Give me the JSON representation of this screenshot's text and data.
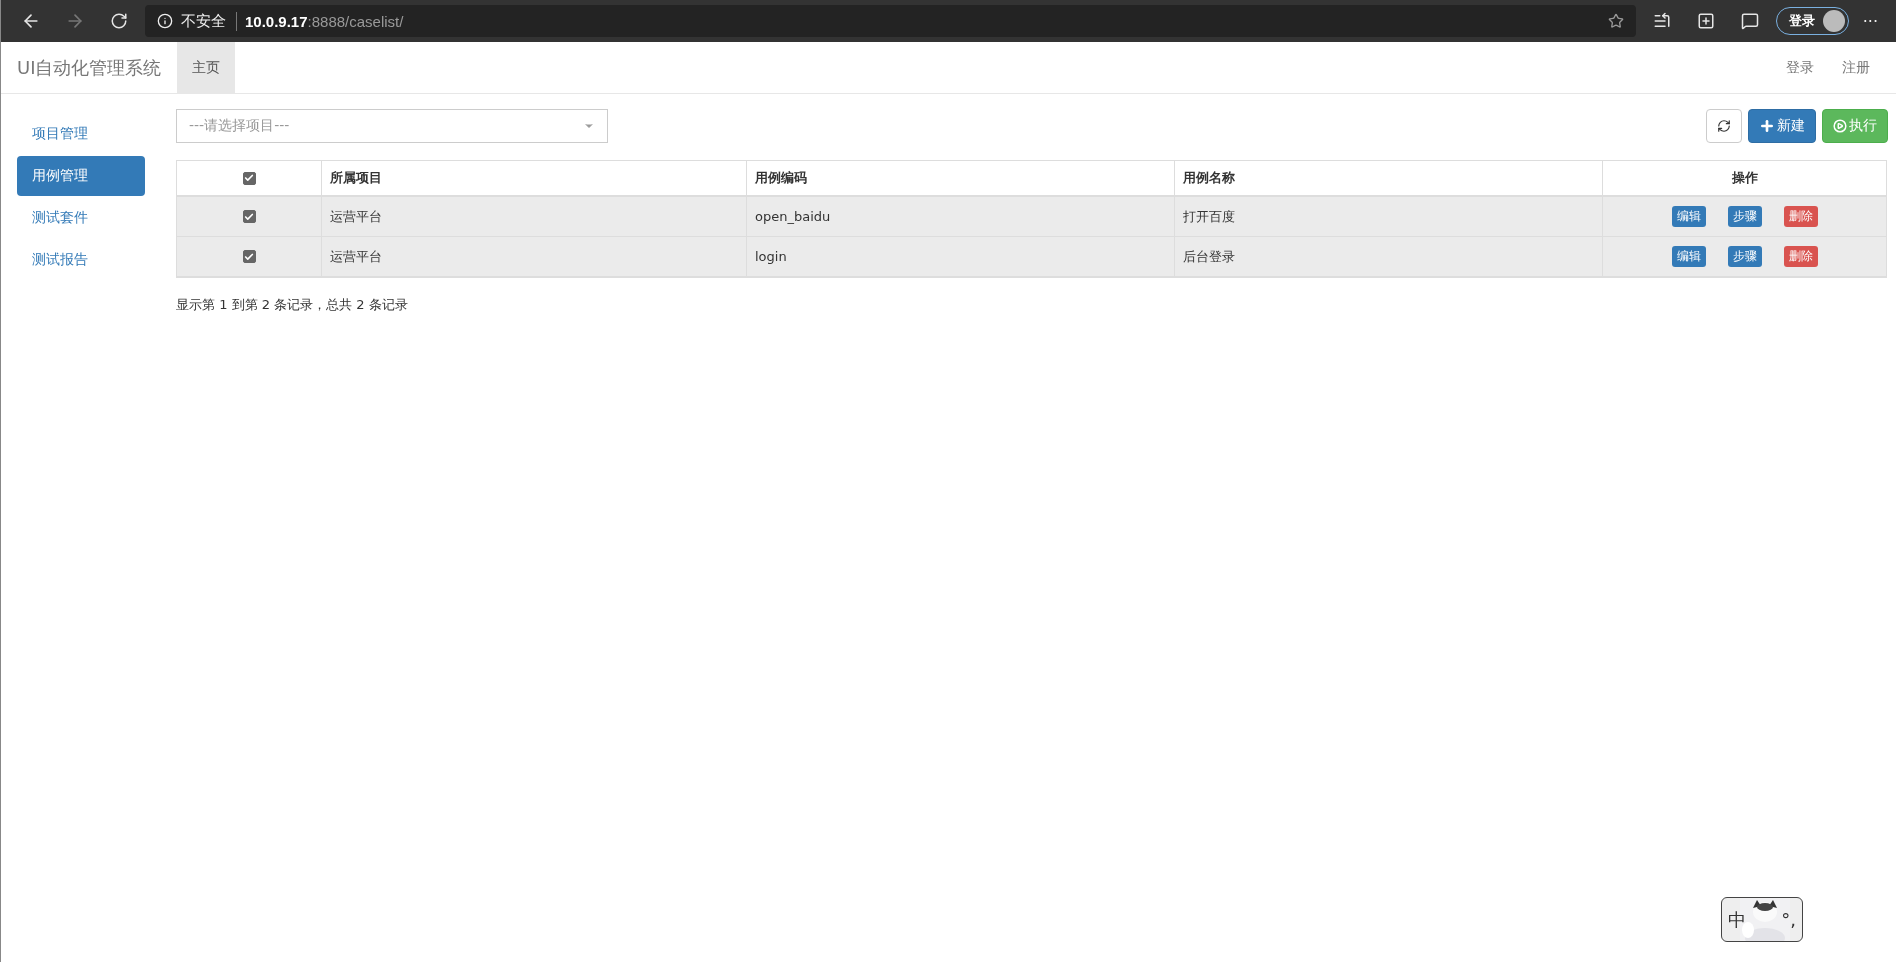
{
  "browser": {
    "security": "不安全",
    "url_host": "10.0.9.17",
    "url_rest": ":8888/caselist/",
    "profile_label": "登录",
    "more": "···"
  },
  "navbar": {
    "brand": "UI自动化管理系统",
    "tabs": [
      {
        "label": "主页",
        "selected": true
      }
    ],
    "links": [
      "登录",
      "注册"
    ]
  },
  "sidebar": {
    "items": [
      {
        "label": "项目管理",
        "selected": false
      },
      {
        "label": "用例管理",
        "selected": true
      },
      {
        "label": "测试套件",
        "selected": false
      },
      {
        "label": "测试报告",
        "selected": false
      }
    ]
  },
  "project_select": {
    "placeholder": "---请选择项目---"
  },
  "toolbar": [
    {
      "kind": "refresh"
    },
    {
      "kind": "new",
      "label": "新建"
    },
    {
      "kind": "run",
      "label": "执行"
    }
  ],
  "table": {
    "all_checked": true,
    "columns": [
      "所属项目",
      "用例编码",
      "用例名称",
      "操作"
    ],
    "rows": [
      {
        "checked": true,
        "project": "运营平台",
        "code": "open_baidu",
        "name": "打开百度",
        "actions": [
          {
            "kind": "primary",
            "label": "编辑"
          },
          {
            "kind": "primary",
            "label": "步骤"
          },
          {
            "kind": "danger",
            "label": "删除"
          }
        ]
      },
      {
        "checked": true,
        "project": "运营平台",
        "code": "login",
        "name": "后台登录",
        "actions": [
          {
            "kind": "primary",
            "label": "编辑"
          },
          {
            "kind": "primary",
            "label": "步骤"
          },
          {
            "kind": "danger",
            "label": "删除"
          }
        ]
      }
    ]
  },
  "pagination_info": "显示第 1 到第 2 条记录，总共 2 条记录",
  "ime": {
    "mode": "中",
    "punct": "°,"
  }
}
